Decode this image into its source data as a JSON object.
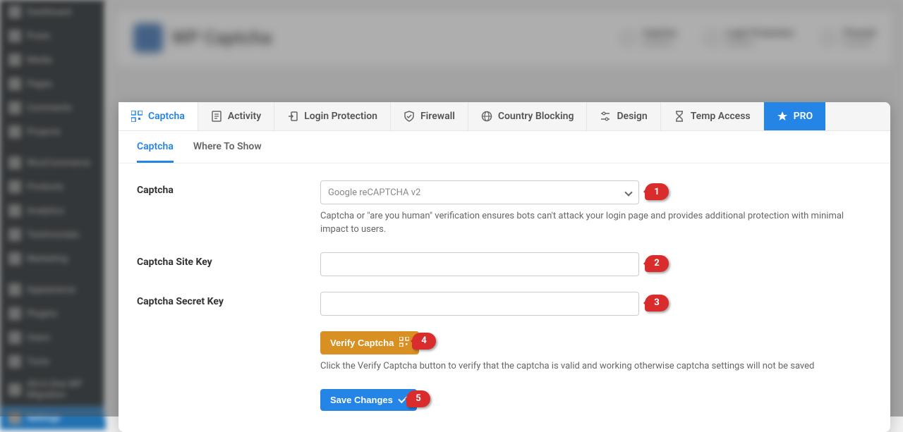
{
  "wp_sidebar": {
    "items": [
      {
        "label": "Dashboard"
      },
      {
        "label": "Posts"
      },
      {
        "label": "Media"
      },
      {
        "label": "Pages"
      },
      {
        "label": "Comments"
      },
      {
        "label": "Projects"
      },
      {
        "label": "WooCommerce"
      },
      {
        "label": "Products"
      },
      {
        "label": "Analytics"
      },
      {
        "label": "Testimonials"
      },
      {
        "label": "Marketing"
      },
      {
        "label": "Appearance"
      },
      {
        "label": "Plugins"
      },
      {
        "label": "Users"
      },
      {
        "label": "Tools"
      },
      {
        "label": "All-in-One WP Migration"
      },
      {
        "label": "Settings"
      }
    ]
  },
  "header": {
    "brand": "WP Captcha",
    "statuses": [
      {
        "title": "Captcha",
        "sub": "Disabled"
      },
      {
        "title": "Login Protection",
        "sub": "Enabled"
      },
      {
        "title": "Firewall",
        "sub": "Enabled"
      }
    ]
  },
  "main_tabs": [
    {
      "label": "Captcha",
      "icon": "qr-icon",
      "active": true
    },
    {
      "label": "Activity",
      "icon": "doc-icon"
    },
    {
      "label": "Login Protection",
      "icon": "login-icon"
    },
    {
      "label": "Firewall",
      "icon": "shield-icon"
    },
    {
      "label": "Country Blocking",
      "icon": "globe-icon"
    },
    {
      "label": "Design",
      "icon": "sliders-icon"
    },
    {
      "label": "Temp Access",
      "icon": "hourglass-icon"
    },
    {
      "label": "PRO",
      "icon": "star-icon",
      "pro": true
    }
  ],
  "sub_tabs": [
    {
      "label": "Captcha",
      "active": true
    },
    {
      "label": "Where To Show"
    }
  ],
  "form": {
    "captcha_label": "Captcha",
    "captcha_select_value": "Google reCAPTCHA v2",
    "captcha_help": "Captcha or \"are you human\" verification ensures bots can't attack your login page and provides additional protection with minimal impact to users.",
    "site_key_label": "Captcha Site Key",
    "site_key_value": "",
    "secret_key_label": "Captcha Secret Key",
    "secret_key_value": "",
    "verify_button": "Verify Captcha",
    "verify_help": "Click the Verify Captcha button to verify that the captcha is valid and working otherwise captcha settings will not be saved",
    "save_button": "Save Changes"
  },
  "badges": [
    "1",
    "2",
    "3",
    "4",
    "5"
  ]
}
